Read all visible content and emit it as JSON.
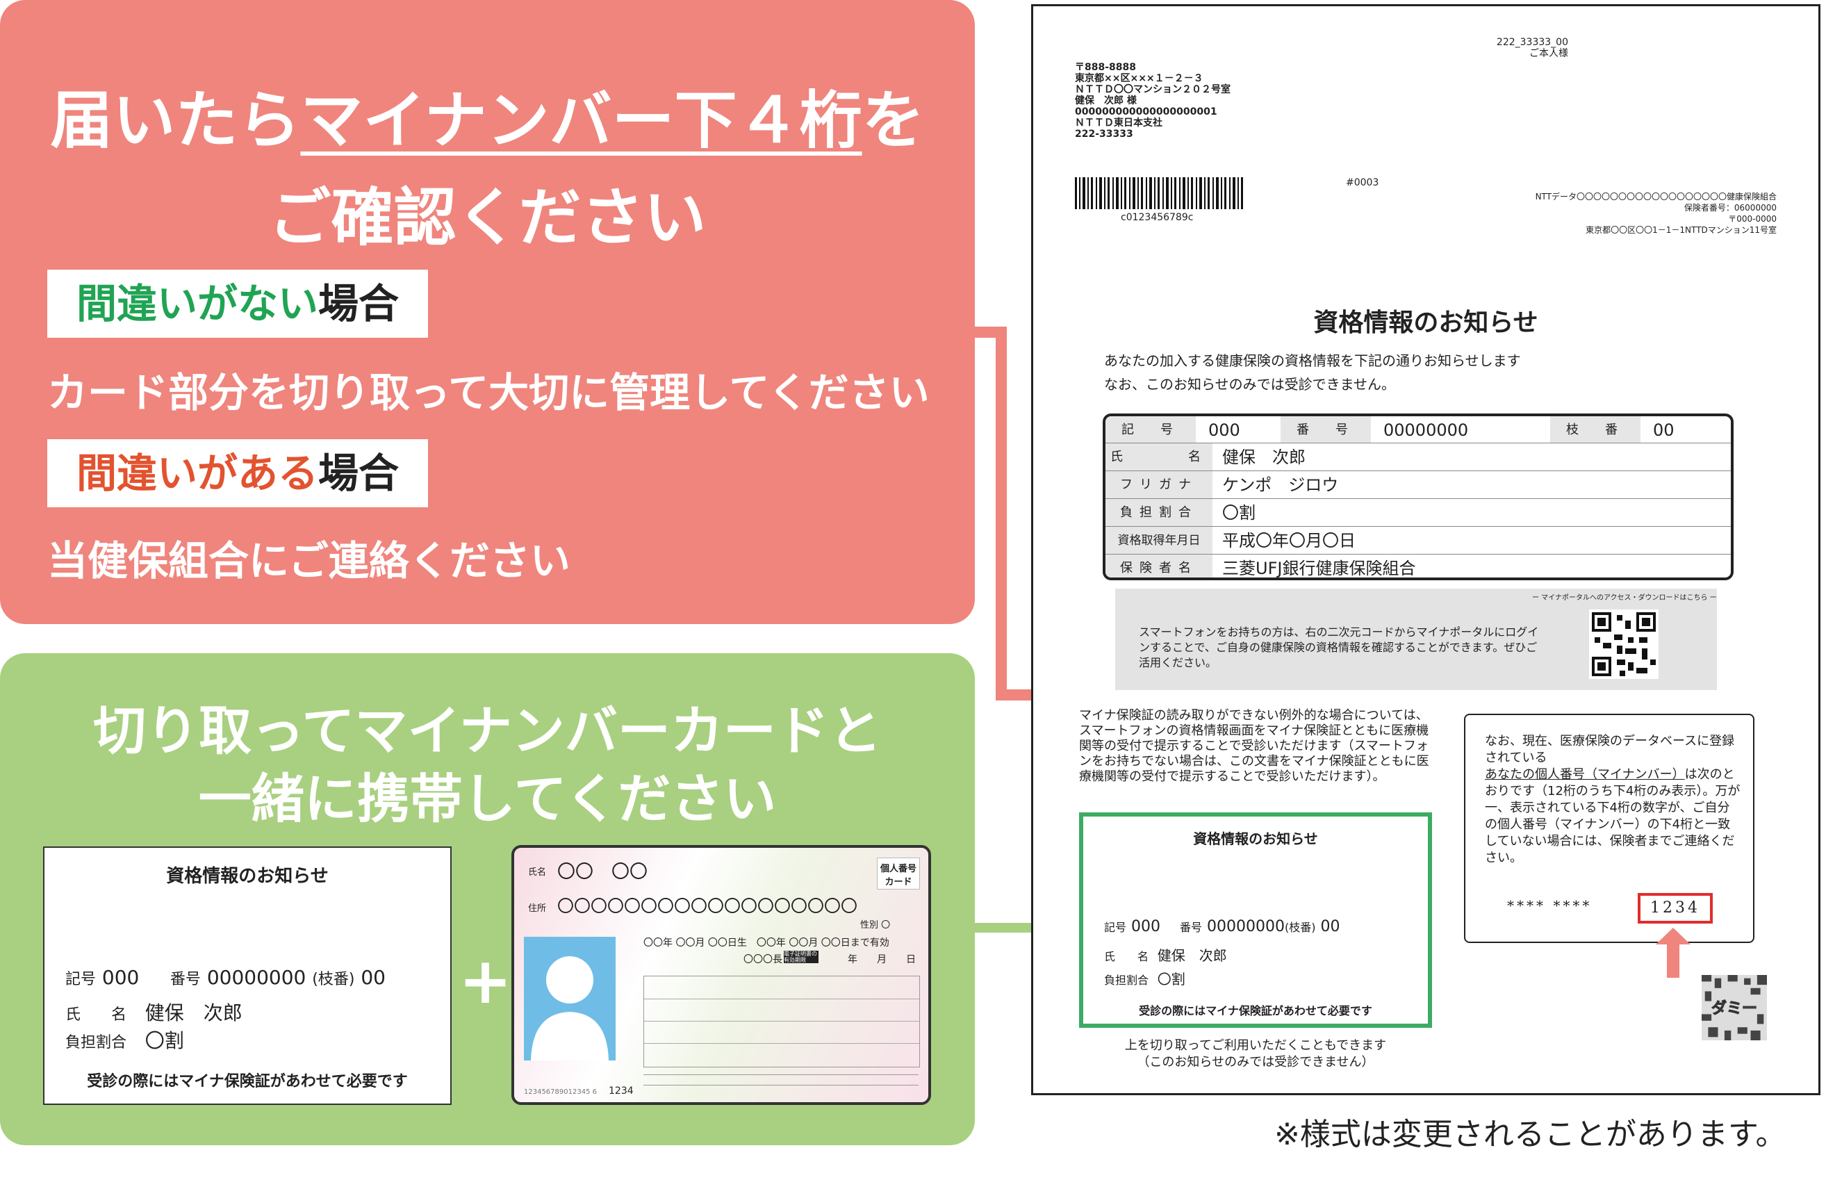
{
  "left": {
    "title_pre": "届いたら",
    "title_emph": "マイナンバー下４桁",
    "title_post": "を",
    "title_line2": "ご確認ください",
    "case_ok": {
      "highlight": "間違いがない",
      "suffix": "場合",
      "desc": "カード部分を切り取って大切に管理してください"
    },
    "case_ng": {
      "highlight": "間違いがある",
      "suffix": "場合",
      "desc": "当健保組合にご連絡ください"
    },
    "carry_line1": "切り取ってマイナンバーカードと",
    "carry_line2": "一緒に携帯してください",
    "plus": "+"
  },
  "card": {
    "title": "資格情報のお知らせ",
    "kigo_label": "記号",
    "kigo": "000",
    "bango_label": "番号",
    "bango": "00000000",
    "edaban_label": "(枝番)",
    "edaban": "00",
    "name_label": "氏　　名",
    "name": "健保　次郎",
    "ratio_label": "負担割合",
    "ratio": "〇割",
    "footer": "受診の際にはマイナ保険証があわせて必要です"
  },
  "mynumber_card": {
    "name_label": "氏名",
    "name_value": "〇〇　〇〇",
    "address_label": "住所",
    "address_value": "〇〇〇〇〇〇〇〇〇〇〇〇〇〇〇〇〇〇",
    "badge_line1": "個人番号",
    "badge_line2": "カード",
    "sex": "性別 〇",
    "dates": "〇〇年 〇〇月 〇〇日生　〇〇年 〇〇月 〇〇日まで有効",
    "mayor": "〇〇〇長",
    "cert_label": "電子証明書の有効期限",
    "cert_date": "年　　月　　日",
    "number": "123456789012345 6",
    "code": "1234"
  },
  "doc": {
    "recipient_code": "222_33333_00",
    "recipient_title": "ご本人様",
    "address_lines": [
      "〒888-8888",
      "東京都××区×××１－２－３",
      "ＮＴＴＤ〇〇マンション２０２号室",
      "健保　次郎 様",
      "000000000000000000001",
      "ＮＴＴＤ東日本支社",
      "222-33333"
    ],
    "barcode_text": "c0123456789c",
    "seq": "#0003",
    "sender_lines": [
      "NTTデータ〇〇〇〇〇〇〇〇〇〇〇〇〇〇〇〇〇〇健康保険組合",
      "保険者番号：06000000",
      "〒000-0000",
      "東京都〇〇区〇〇1－1－1NTTDマンション11号室"
    ],
    "title": "資格情報のお知らせ",
    "intro1": "あなたの加入する健康保険の資格情報を下記の通りお知らせします",
    "intro2": "なお、このお知らせのみでは受診できません。",
    "table": {
      "kigo_label": "記　号",
      "kigo": "000",
      "bango_label": "番　号",
      "bango": "00000000",
      "edaban_label": "枝　番",
      "edaban": "00",
      "name_label": "氏　　　名",
      "name": "健保　次郎",
      "kana_label": "フリガナ",
      "kana": "ケンポ　ジロウ",
      "ratio_label": "負担割合",
      "ratio": "〇割",
      "date_label": "資格取得年月日",
      "date": "平成〇年〇月〇日",
      "insurer_label": "保険者名",
      "insurer": "三菱UFJ銀行健康保険組合"
    },
    "portal_caption": "ー マイナポータルへのアクセス・ダウンロードはこちら ー",
    "portal_text": "スマートフォンをお持ちの方は、右の二次元コードからマイナポータルにログインすることで、ご自身の健康保険の資格情報を確認することができます。ぜひご活用ください。",
    "exception_text": "マイナ保険証の読み取りができない例外的な場合については、スマートフォンの資格情報画面をマイナ保険証とともに医療機関等の受付で提示することで受診いただけます（スマートフォンをお持ちでない場合は、この文書をマイナ保険証とともに医療機関等の受付で提示することで受診いただけます）。",
    "cut_note1": "上を切り取ってご利用いただくこともできます",
    "cut_note2": "（このお知らせのみでは受診できません）",
    "number_note_pre": "なお、現在、医療保険のデータベースに登録されている",
    "number_note_link": "あなたの個人番号（マイナンバー）",
    "number_note_post": "は次のとおりです（12桁のうち下4桁のみ表示）。万が一、表示されている下4桁の数字が、ご自分の個人番号（マイナンバー）の下4桁と一致していない場合には、保険者までご連絡ください。",
    "masked": "**** ****",
    "last4": "1234",
    "dummy": "ダミー"
  },
  "footnote": "※様式は変更されることがあります。",
  "colors": {
    "red_panel": "#ef857d",
    "green_panel": "#a8d080",
    "green_text": "#20a453",
    "red_text": "#e2532f",
    "cut_border": "#3cab64"
  }
}
